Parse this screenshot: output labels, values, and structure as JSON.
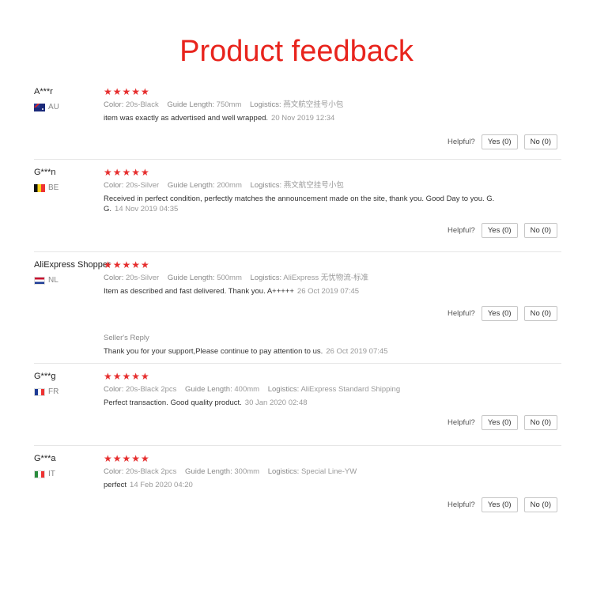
{
  "page": {
    "title": "Product feedback"
  },
  "labels": {
    "color": "Color:",
    "guide_length": "Guide Length:",
    "logistics": "Logistics:",
    "helpful": "Helpful?",
    "seller_reply": "Seller's Reply"
  },
  "reviews": [
    {
      "user": "A***r",
      "country": "AU",
      "stars": "★★★★★",
      "rating": 5,
      "color": "20s-Black",
      "guide_length": "750mm",
      "logistics": "燕文航空挂号小包",
      "text": "item was exactly as advertised and well wrapped.",
      "date": "20 Nov 2019 12:34",
      "yes": "Yes (0)",
      "no": "No (0)"
    },
    {
      "user": "G***n",
      "country": "BE",
      "stars": "★★★★★",
      "rating": 5,
      "color": "20s-Silver",
      "guide_length": "200mm",
      "logistics": "燕文航空挂号小包",
      "text": "Received in perfect condition, perfectly matches the announcement made on the site, thank you. Good Day to you. G. G.",
      "date": "14 Nov 2019 04:35",
      "yes": "Yes (0)",
      "no": "No (0)"
    },
    {
      "user": "AliExpress Shopper",
      "country": "NL",
      "stars": "★★★★★",
      "rating": 5,
      "color": "20s-Silver",
      "guide_length": "500mm",
      "logistics": "AliExpress 无忧物流-标准",
      "text": "Item as described and fast delivered. Thank you. A+++++",
      "date": "26 Oct 2019 07:45",
      "yes": "Yes (0)",
      "no": "No (0)",
      "seller_reply_text": "Thank you for your support,Please continue to pay attention to us.",
      "seller_reply_date": "26 Oct 2019 07:45"
    },
    {
      "user": "G***g",
      "country": "FR",
      "stars": "★★★★★",
      "rating": 5,
      "color": "20s-Black 2pcs",
      "guide_length": "400mm",
      "logistics": "AliExpress Standard Shipping",
      "text": "Perfect transaction. Good quality product.",
      "date": "30 Jan 2020 02:48",
      "yes": "Yes (0)",
      "no": "No (0)"
    },
    {
      "user": "G***a",
      "country": "IT",
      "stars": "★★★★★",
      "rating": 5,
      "color": "20s-Black 2pcs",
      "guide_length": "300mm",
      "logistics": "Special Line-YW",
      "text": "perfect",
      "date": "14 Feb 2020 04:20",
      "yes": "Yes (0)",
      "no": "No (0)"
    }
  ],
  "colors": {
    "title": "#e8241d",
    "stars": "#e62e2e",
    "muted": "#999999"
  },
  "icons": [
    "star-icon",
    "flag-au-icon",
    "flag-be-icon",
    "flag-nl-icon",
    "flag-fr-icon",
    "flag-it-icon"
  ]
}
